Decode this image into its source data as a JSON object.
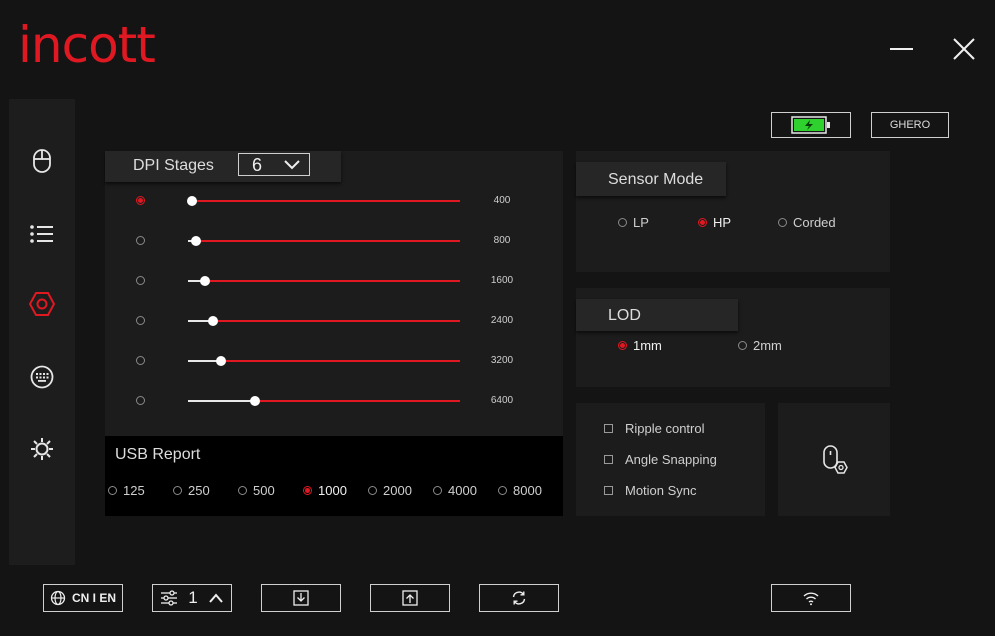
{
  "app": {
    "logo": "incott"
  },
  "window": {
    "minimize_icon": "minimize-icon",
    "close_icon": "close-icon"
  },
  "sidebar": {
    "items": [
      {
        "name": "mouse",
        "icon": "mouse-icon",
        "active": false
      },
      {
        "name": "list",
        "icon": "list-icon",
        "active": false
      },
      {
        "name": "settings",
        "icon": "hexagon-gear-icon",
        "active": true
      },
      {
        "name": "keyboard",
        "icon": "keypad-icon",
        "active": false
      },
      {
        "name": "lighting",
        "icon": "sun-icon",
        "active": false
      }
    ]
  },
  "header": {
    "battery_icon": "battery-charging-icon",
    "device_name": "GHERO"
  },
  "dpi": {
    "title": "DPI Stages",
    "stage_count": "6",
    "selected_index": 0,
    "max_dpi": 26000,
    "stages": [
      {
        "value": "400",
        "dpi": 400,
        "selected": true
      },
      {
        "value": "800",
        "dpi": 800,
        "selected": false
      },
      {
        "value": "1600",
        "dpi": 1600,
        "selected": false
      },
      {
        "value": "2400",
        "dpi": 2400,
        "selected": false
      },
      {
        "value": "3200",
        "dpi": 3200,
        "selected": false
      },
      {
        "value": "6400",
        "dpi": 6400,
        "selected": false
      }
    ]
  },
  "usb_report": {
    "title": "USB Report",
    "options": [
      "125",
      "250",
      "500",
      "1000",
      "2000",
      "4000",
      "8000"
    ],
    "selected": "1000"
  },
  "sensor_mode": {
    "title": "Sensor Mode",
    "options": [
      "LP",
      "HP",
      "Corded"
    ],
    "selected": "HP"
  },
  "lod": {
    "title": "LOD",
    "options": [
      "1mm",
      "2mm"
    ],
    "selected": "1mm"
  },
  "toggles": [
    {
      "label": "Ripple control",
      "checked": false
    },
    {
      "label": "Angle Snapping",
      "checked": false
    },
    {
      "label": "Motion Sync",
      "checked": false
    }
  ],
  "footer": {
    "language": "CN I EN",
    "profile": "1",
    "buttons": [
      "import-icon",
      "export-icon",
      "reset-icon",
      "wireless-icon"
    ]
  },
  "colors": {
    "accent": "#e01822",
    "battery": "#2ed12e",
    "background": "#141414",
    "panel": "#1c1c1c"
  }
}
